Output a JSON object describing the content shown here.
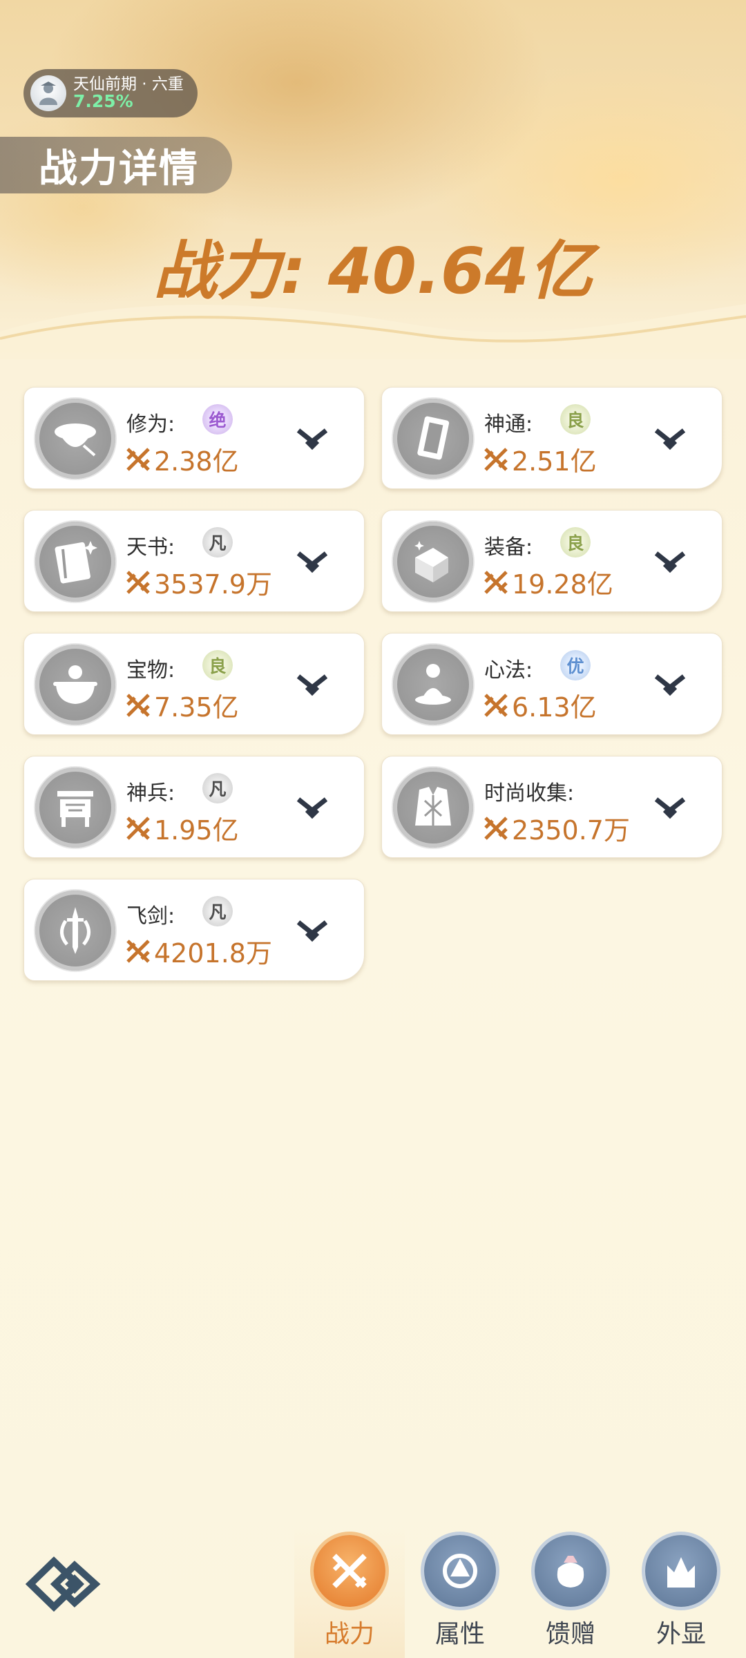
{
  "header": {
    "level_name": "天仙前期 · 六重",
    "level_progress": "7.25%",
    "page_title": "战力详情",
    "total_power": "战力: 40.64亿"
  },
  "cards": [
    {
      "name": "修为:",
      "grade": "绝",
      "grade_type": "jue",
      "value": "2.38亿",
      "icon": "cultivator-hat-icon"
    },
    {
      "name": "神通:",
      "grade": "良",
      "grade_type": "liang",
      "value": "2.51亿",
      "icon": "scroll-book-icon"
    },
    {
      "name": "天书:",
      "grade": "凡",
      "grade_type": "fan",
      "value": "3537.9万",
      "icon": "heavenly-book-icon"
    },
    {
      "name": "装备:",
      "grade": "良",
      "grade_type": "liang",
      "value": "19.28亿",
      "icon": "equipment-cube-icon"
    },
    {
      "name": "宝物:",
      "grade": "良",
      "grade_type": "liang",
      "value": "7.35亿",
      "icon": "treasure-cauldron-icon"
    },
    {
      "name": "心法:",
      "grade": "优",
      "grade_type": "you",
      "value": "6.13亿",
      "icon": "meditation-icon"
    },
    {
      "name": "神兵:",
      "grade": "凡",
      "grade_type": "fan",
      "value": "1.95亿",
      "icon": "bronze-ding-icon"
    },
    {
      "name": "时尚收集:",
      "grade": "",
      "grade_type": "",
      "value": "2350.7万",
      "icon": "robe-icon"
    },
    {
      "name": "飞剑:",
      "grade": "凡",
      "grade_type": "fan",
      "value": "4201.8万",
      "icon": "flying-sword-icon"
    }
  ],
  "nav": [
    {
      "label": "战力",
      "icon": "crossed-swords-icon",
      "active": true
    },
    {
      "label": "属性",
      "icon": "attribute-emblem-icon",
      "active": false
    },
    {
      "label": "馈赠",
      "icon": "gift-pouch-icon",
      "active": false
    },
    {
      "label": "外显",
      "icon": "appearance-crown-icon",
      "active": false
    }
  ],
  "colors": {
    "power_orange": "#cc7a2a",
    "value_orange": "#c6742c",
    "nav_active": "#e47a2a",
    "nav_inactive": "#5e7797"
  }
}
